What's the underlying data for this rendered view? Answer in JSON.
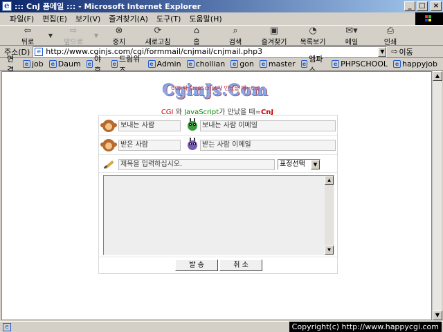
{
  "window": {
    "title": "::: CnJ 폼메일 ::: - Microsoft Internet Explorer"
  },
  "menu": [
    "파일(F)",
    "편집(E)",
    "보기(V)",
    "즐겨찾기(A)",
    "도구(T)",
    "도움말(H)"
  ],
  "toolbar": {
    "back": "뒤로",
    "forward": "앞으로",
    "stop": "중지",
    "refresh": "새로고침",
    "home": "홈",
    "search": "검색",
    "favorites": "즐겨찾기",
    "history": "목록보기",
    "mail": "메일",
    "print": "인쇄"
  },
  "address": {
    "label": "주소(D)",
    "url": "http://www.cginjs.com/cgi/formmail/cnjmail/cnjmail.php3",
    "go": "이동"
  },
  "links": {
    "label": "연결",
    "items": [
      "job",
      "Daum",
      "야후",
      "드림위즈",
      "Admin",
      "chollian",
      "gon",
      "master",
      "엠파스",
      "PHPSCHOOL",
      "happyjob"
    ]
  },
  "page": {
    "logo_text": "CginJs.Com",
    "logo_small": "CGI 와 JavaScript가 만났을 때=CnJ",
    "tagline_cgi": "CGI",
    "tagline_mid1": " 와 ",
    "tagline_js": "JavaScript",
    "tagline_mid2": "가 만났을 때=",
    "tagline_cnj": "CnJ"
  },
  "form": {
    "sender_name": "보내는 사람",
    "sender_email": "보내는 사람 이메일",
    "receiver_name": "받은 사람",
    "receiver_email": "받는 사람 이메일",
    "subject": "제목을 입력하십시오.",
    "emoticon_select": "표정선택",
    "body": "",
    "send_label": "발 송",
    "cancel_label": "취 소"
  },
  "status": {
    "copyright": "Copyright(c) http://www.happycgi.com"
  }
}
